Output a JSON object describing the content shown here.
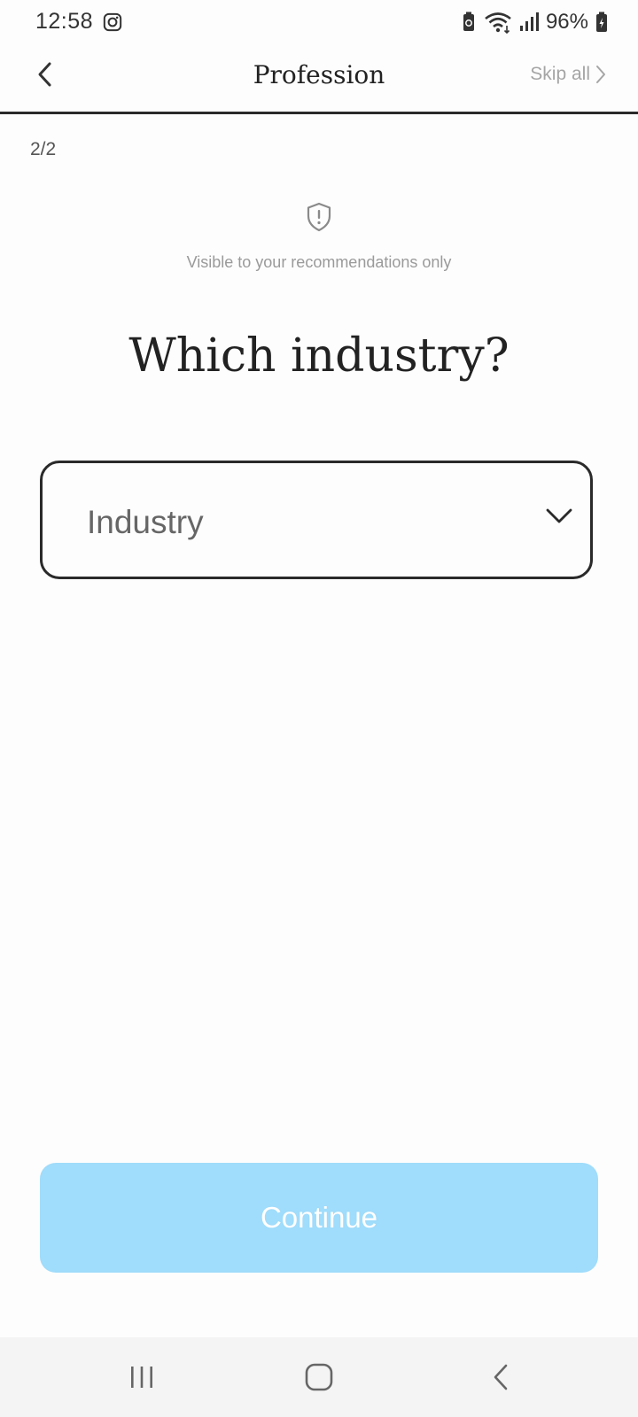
{
  "status_bar": {
    "time": "12:58",
    "battery": "96%",
    "icons": [
      "instagram-icon",
      "battery-saver-icon",
      "wifi-icon",
      "signal-icon",
      "battery-icon"
    ]
  },
  "header": {
    "title": "Profession",
    "skip_label": "Skip all",
    "back_icon": "chevron-left-icon",
    "skip_icon": "chevron-right-icon"
  },
  "progress": {
    "step": "2/2"
  },
  "privacy": {
    "icon": "shield-alert-icon",
    "note": "Visible to your recommendations only"
  },
  "question": {
    "title": "Which industry?"
  },
  "industry_select": {
    "placeholder": "Industry",
    "icon": "chevron-down-icon"
  },
  "actions": {
    "continue_label": "Continue",
    "continue_color": "#a0dcfb"
  },
  "nav_bar": {
    "icons": [
      "recents-icon",
      "home-icon",
      "back-icon"
    ]
  }
}
